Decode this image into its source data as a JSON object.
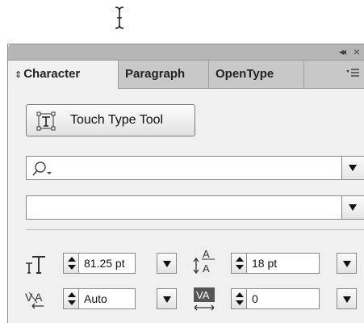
{
  "panel": {
    "tabs": [
      {
        "label": "Character"
      },
      {
        "label": "Paragraph"
      },
      {
        "label": "OpenType"
      }
    ]
  },
  "touch_type": {
    "label": "Touch Type Tool"
  },
  "font_family": {
    "value": ""
  },
  "font_style": {
    "value": ""
  },
  "font_size": {
    "value": "81.25 pt"
  },
  "leading": {
    "value": "18 pt"
  },
  "kerning": {
    "value": "Auto"
  },
  "tracking": {
    "value": "0"
  },
  "colors": {
    "panel": "#f0f0f0",
    "titlebar": "#b6b6b6",
    "tabbar": "#c8c8c8"
  }
}
